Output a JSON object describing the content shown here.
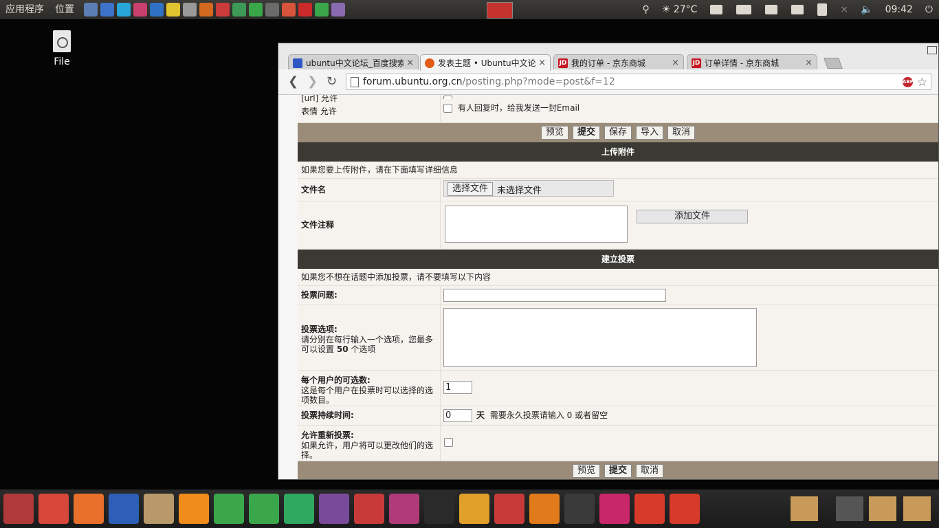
{
  "top_panel": {
    "apps_menu": "应用程序",
    "places_menu": "位置",
    "launcher_colors": [
      "#5b7fb5",
      "#3d73c9",
      "#29a6d8",
      "#c93f6e",
      "#2f72c4",
      "#e0c430",
      "#999999",
      "#d2691e",
      "#cc3b3b",
      "#3c9a56",
      "#3aa74a",
      "#6b6b6b",
      "#d8543a",
      "#cc2a2a",
      "#3aa74a",
      "#8a6ab0"
    ],
    "temperature": "27°C",
    "clock": "09:42"
  },
  "desktop": {
    "file_icon_label": "File"
  },
  "browser": {
    "tabs": [
      {
        "title": "ubuntu中文论坛_百度搜索",
        "fav_color": "#2f56c6",
        "fav_text": ""
      },
      {
        "title": "发表主题 • Ubuntu中文论坛",
        "fav_color": "#e25b19",
        "fav_text": ""
      },
      {
        "title": "我的订单 - 京东商城",
        "fav_color": "#c81623",
        "fav_text": "JD"
      },
      {
        "title": "订单详情 - 京东商城",
        "fav_color": "#c81623",
        "fav_text": "JD"
      }
    ],
    "tab_close": "×",
    "url_host": "forum.ubuntu.org.cn",
    "url_path": "/posting.php?mode=post&f=12",
    "abp_label": "ABP"
  },
  "form": {
    "top_options": {
      "url_label": "[url] 允许",
      "smilies_label": "表情 允许",
      "email_notify": "有人回复时，给我发送一封Email"
    },
    "buttons_top": {
      "preview": "预览",
      "submit": "提交",
      "save": "保存",
      "import": "导入",
      "cancel": "取消"
    },
    "attach": {
      "header": "上传附件",
      "note": "如果您要上传附件，请在下面填写详细信息",
      "filename_label": "文件名",
      "choose_file": "选择文件",
      "no_file": "未选择文件",
      "comment_label": "文件注释",
      "add_file": "添加文件"
    },
    "poll": {
      "header": "建立投票",
      "note": "如果您不想在话题中添加投票，请不要填写以下内容",
      "question_label": "投票问题:",
      "options_label": "投票选项:",
      "options_help_a": "请分别在每行输入一个选项，您最多可以设置",
      "options_max": "50",
      "options_help_b": "个选项",
      "max_per_user_label": "每个用户的可选数:",
      "max_per_user_help": "这是每个用户在投票时可以选择的选项数目。",
      "max_per_user_value": "1",
      "duration_label": "投票持续时间:",
      "duration_value": "0",
      "duration_unit": "天",
      "duration_help": "需要永久投票请输入 0 或者留空",
      "revote_label": "允许重新投票:",
      "revote_help": "如果允许，用户将可以更改他们的选择。"
    },
    "buttons_bottom": {
      "preview": "预览",
      "submit": "提交",
      "cancel": "取消"
    }
  },
  "dock": {
    "left_colors": [
      "#b03a3a",
      "#d8483a",
      "#e8702a",
      "#2d5fb8",
      "#b89a6a",
      "#f08c1a",
      "#3aa74a",
      "#3aa74a",
      "#2fa860",
      "#7a4a9a",
      "#c83a3a",
      "#b03a7a",
      "#2a2a2a",
      "#e0a02a",
      "#c83a3a",
      "#e07a1a",
      "#3a3a3a",
      "#c8286a",
      "#d83a2a",
      "#d83a2a"
    ],
    "right_colors": [
      "#c89a5a",
      "#555555",
      "#c89a5a",
      "#c89a5a"
    ]
  }
}
